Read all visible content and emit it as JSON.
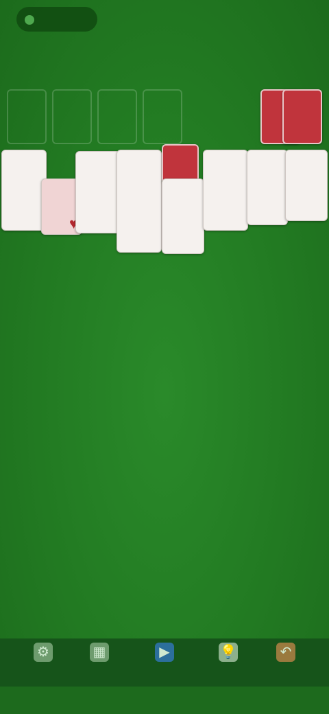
{
  "status": {
    "time": ""
  },
  "stats": [
    {
      "label": "",
      "value": ""
    },
    {
      "label": "",
      "value": ""
    },
    {
      "label": "",
      "value": ""
    }
  ],
  "toolbar": [
    {
      "icon": "settings-icon",
      "label": ""
    },
    {
      "icon": "games-icon",
      "label": ""
    },
    {
      "icon": "play-icon",
      "label": ""
    },
    {
      "icon": "hint-icon",
      "label": ""
    },
    {
      "icon": "undo-icon",
      "label": ""
    }
  ],
  "colors": {
    "felt": "#237a23",
    "card_back": "#c0343c",
    "card_face": "#f5f1ee"
  }
}
